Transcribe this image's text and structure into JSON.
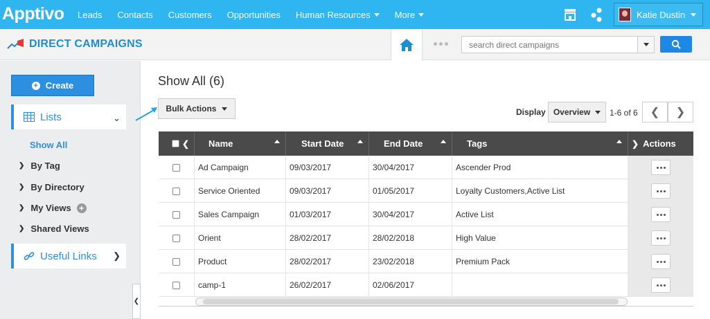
{
  "nav": {
    "logo": "Apptivo",
    "items": [
      "Leads",
      "Contacts",
      "Customers",
      "Opportunities",
      "Human Resources",
      "More"
    ],
    "user": "Katie Dustin"
  },
  "header": {
    "title": "DIRECT CAMPAIGNS",
    "search_placeholder": "search direct campaigns"
  },
  "sidebar": {
    "create": "Create",
    "lists": "Lists",
    "show_all": "Show All",
    "links": [
      "By Tag",
      "By Directory",
      "My Views",
      "Shared Views"
    ],
    "useful_links": "Useful Links"
  },
  "main": {
    "title": "Show All (6)",
    "bulk_actions": "Bulk Actions",
    "display_label": "Display",
    "view_select": "Overview",
    "page_count": "1-6 of 6"
  },
  "table": {
    "columns": [
      "Name",
      "Start Date",
      "End Date",
      "Tags",
      "Actions"
    ],
    "rows": [
      {
        "name": "Ad Campaign",
        "start": "09/03/2017",
        "end": "30/04/2017",
        "tags": "Ascender Prod"
      },
      {
        "name": "Service Oriented",
        "start": "09/03/2017",
        "end": "01/05/2017",
        "tags": "Loyalty Customers,Active List"
      },
      {
        "name": "Sales Campaign",
        "start": "01/03/2017",
        "end": "30/04/2017",
        "tags": "Active List"
      },
      {
        "name": "Orient",
        "start": "28/02/2017",
        "end": "28/02/2018",
        "tags": "High Value"
      },
      {
        "name": "Product",
        "start": "28/02/2017",
        "end": "23/02/2018",
        "tags": "Premium Pack"
      },
      {
        "name": "camp-1",
        "start": "26/02/2017",
        "end": "02/06/2017",
        "tags": ""
      }
    ]
  },
  "colors": {
    "topbar": "#2fb5ef",
    "accent": "#2d8fe0",
    "table_header": "#4a4a4a"
  }
}
